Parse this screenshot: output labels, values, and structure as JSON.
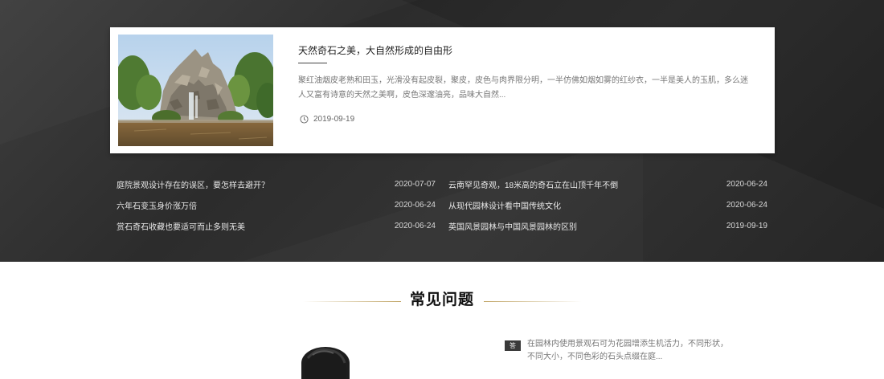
{
  "featured": {
    "title": "天然奇石之美，大自然形成的自由形",
    "description": "聚红油烟皮老熟和田玉，光滑没有起皮裂，聚皮，皮色与肉界限分明，一半仿佛如烟如雾的红纱衣，一半是美人的玉肌，多么迷人又富有诗意的天然之美啊，皮色深邃油亮，品味大自然...",
    "date": "2019-09-19",
    "image_alt": "rock garden waterfall photo",
    "date_icon": "clock-icon"
  },
  "news_left": [
    {
      "title": "庭院景观设计存在的误区，要怎样去避开？",
      "date": "2020-07-07"
    },
    {
      "title": "六年石变玉身价涨万倍",
      "date": "2020-06-24"
    },
    {
      "title": "赏石奇石收藏也要适可而止多则无美",
      "date": "2020-06-24"
    }
  ],
  "news_right": [
    {
      "title": "云南罕见奇观，18米高的奇石立在山顶千年不倒",
      "date": "2020-06-24"
    },
    {
      "title": "从现代园林设计看中国传统文化",
      "date": "2020-06-24"
    },
    {
      "title": "英国风景园林与中国风景园林的区别",
      "date": "2019-09-19"
    }
  ],
  "faq": {
    "heading": "常见问题",
    "answer_badge": "答",
    "answer_text": "在园林内使用景观石可为花园增添生机活力，不同形状，不同大小，不同色彩的石头点缀在庭..."
  },
  "colors": {
    "dark_band": "#2f2f2f",
    "accent_gold": "#c4aa6e",
    "card_bg": "#ffffff"
  }
}
